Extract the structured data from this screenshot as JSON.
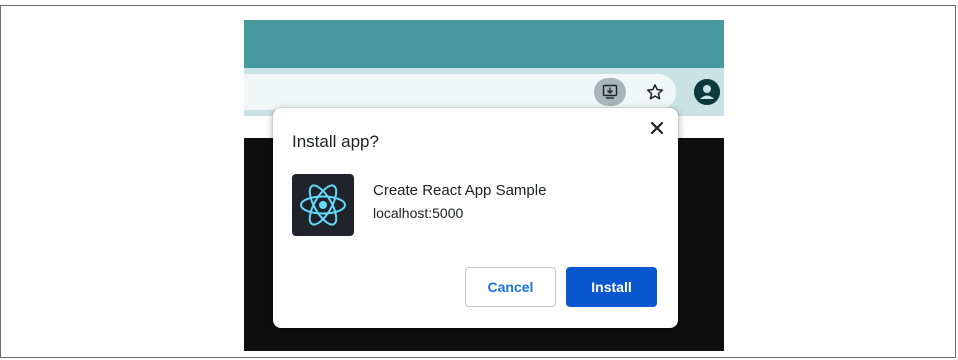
{
  "colors": {
    "title_bar": "#46999c",
    "toolbar": "#c9e2e4",
    "page_bg": "#0f0f0f",
    "primary_button": "#0b57d0",
    "link_text": "#1a73e8",
    "react_logo": "#61dafb"
  },
  "toolbar": {
    "install_icon": "install-app-icon",
    "bookmark_icon": "star-icon",
    "profile_icon": "avatar-icon"
  },
  "dialog": {
    "title": "Install app?",
    "close_icon": "close-icon",
    "app": {
      "icon": "react-logo-icon",
      "name": "Create React App Sample",
      "origin": "localhost:5000"
    },
    "cancel_label": "Cancel",
    "install_label": "Install"
  }
}
